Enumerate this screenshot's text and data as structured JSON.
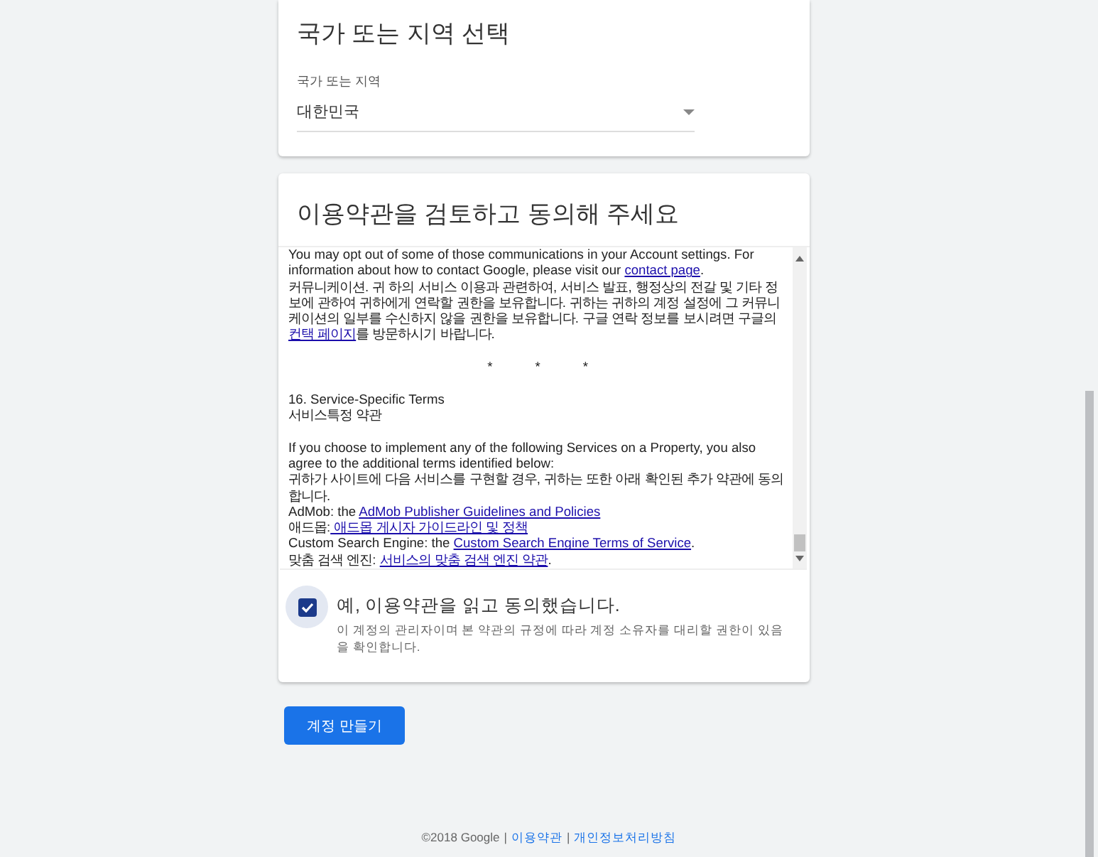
{
  "region_card": {
    "title": "국가 또는 지역 선택",
    "field": {
      "label": "국가 또는 지역",
      "value": "대한민국"
    }
  },
  "terms_card": {
    "title": "이용약관을 검토하고 동의해 주세요",
    "blocks": [
      {
        "kind": "text",
        "lines": [
          [
            {
              "text": "You may opt out of some of those communications in your Account settings. For information about how to contact Google, please visit our ",
              "link": false
            },
            {
              "text": "contact page",
              "link": true
            },
            {
              "text": ".",
              "link": false
            }
          ],
          [
            {
              "text": "커뮤니케이션. 귀 하의 서비스 이용과 관련하여, 서비스 발표, 행정상의 전갈 및 기타 정보에 관하여 귀하에게 연락할 권한을 보유합니다. 귀하는 귀하의 계정 설정에 그 커뮤니케이션의 일부를 수신하지 않을 권한을 보유합니다. 구글 연락 정보를 보시려면 구글의 ",
              "link": false
            },
            {
              "text": "컨택 페이지",
              "link": true
            },
            {
              "text": "를 방문하시기 바랍니다.",
              "link": false
            }
          ]
        ]
      },
      {
        "kind": "separator",
        "marks": [
          "*",
          "*",
          "*"
        ]
      },
      {
        "kind": "text",
        "lines": [
          [
            {
              "text": "16. Service-Specific Terms",
              "link": false
            }
          ],
          [
            {
              "text": "서비스특정 약관",
              "link": false
            }
          ]
        ]
      },
      {
        "kind": "text",
        "lines": [
          [
            {
              "text": "If you choose to implement any of the following Services on a Property, you also agree to the additional terms identified below:",
              "link": false
            }
          ],
          [
            {
              "text": "귀하가 사이트에 다음 서비스를 구현할 경우, 귀하는 또한 아래 확인된 추가 약관에 동의합니다.",
              "link": false
            }
          ],
          [
            {
              "text": "AdMob: the ",
              "link": false
            },
            {
              "text": "AdMob Publisher Guidelines and Policies",
              "link": true
            }
          ],
          [
            {
              "text": "애드몹:",
              "link": false
            },
            {
              "text": " 애드몹 게시자 가이드라인 및 정책",
              "link": true
            }
          ],
          [
            {
              "text": "Custom Search Engine: the ",
              "link": false
            },
            {
              "text": "Custom Search Engine Terms of Service",
              "link": true
            },
            {
              "text": ".",
              "link": false
            }
          ],
          [
            {
              "text": "맞춤 검색 엔진: ",
              "link": false
            },
            {
              "text": "서비스의 맞춤 검색 엔진 약관",
              "link": true
            },
            {
              "text": ".",
              "link": false
            }
          ]
        ]
      }
    ],
    "agreement": {
      "checked": true,
      "label": "예, 이용약관을 읽고 동의했습니다.",
      "note": "이 계정의 관리자이며 본 약관의 규정에 따라 계정 소유자를 대리할 권한이 있음을 확인합니다."
    }
  },
  "create_button": "계정 만들기",
  "footer": [
    {
      "kind": "text",
      "text": "©2018 Google"
    },
    {
      "kind": "divider",
      "text": "|"
    },
    {
      "kind": "link",
      "text": "이용약관"
    },
    {
      "kind": "divider",
      "text": "|"
    },
    {
      "kind": "link",
      "text": "개인정보처리방침"
    }
  ]
}
